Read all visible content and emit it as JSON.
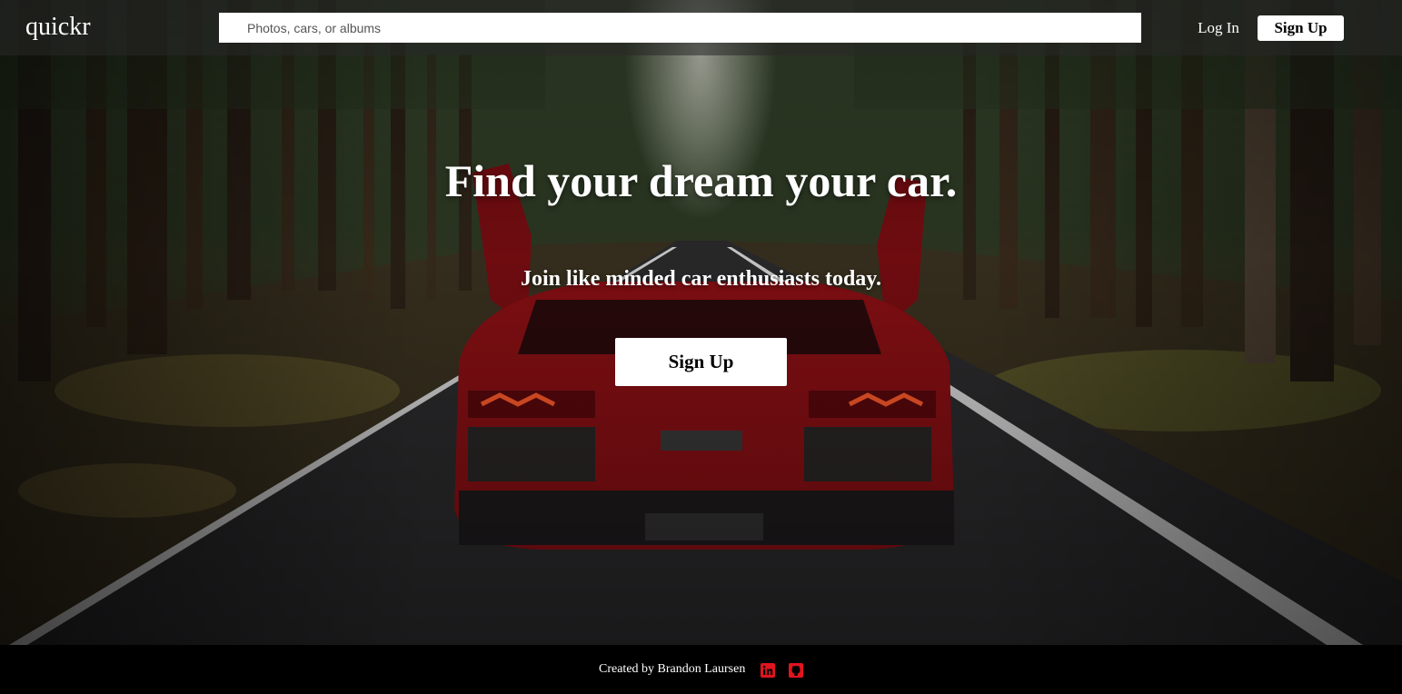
{
  "navbar": {
    "logo": "quickr",
    "search_placeholder": "Photos, cars, or albums",
    "login_label": "Log In",
    "signup_label": "Sign Up"
  },
  "hero": {
    "headline": "Find your dream your car.",
    "subheadline": "Join like minded car enthusiasts today.",
    "signup_label": "Sign Up",
    "background": "forest road with red sports car rear view"
  },
  "footer": {
    "credit": "Created by Brandon Laursen",
    "icons": [
      "linkedin-icon",
      "github-icon"
    ],
    "icon_color": "#e0141e"
  },
  "colors": {
    "nav_bg": "#2a2a2a",
    "button_bg": "#ffffff",
    "text": "#ffffff",
    "footer_bg": "#000000",
    "car_red": "#8a0f14"
  }
}
